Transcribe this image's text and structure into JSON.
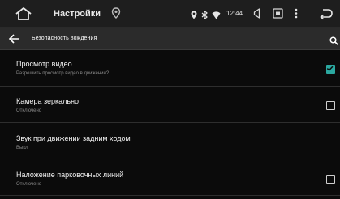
{
  "statusbar": {
    "app_title": "Настройки",
    "time": "12:44"
  },
  "toolbar": {
    "title": "Безопасность вождения"
  },
  "settings": [
    {
      "title": "Просмотр видео",
      "subtitle": "Разрешить просмотр видео в движении?",
      "checkbox": true,
      "checked": true
    },
    {
      "title": "Камера зеркально",
      "subtitle": "Отключено",
      "checkbox": true,
      "checked": false
    },
    {
      "title": "Звук при движении задним ходом",
      "subtitle": "Выкл",
      "checkbox": false,
      "checked": false
    },
    {
      "title": "Наложение парковочных линий",
      "subtitle": "Отключено",
      "checkbox": true,
      "checked": false
    }
  ],
  "colors": {
    "accent": "#2ba8a0",
    "background": "#0b0b0b",
    "toolbar": "#2b2b2b"
  }
}
